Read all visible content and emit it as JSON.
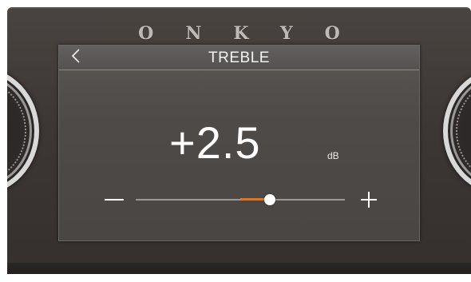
{
  "device": {
    "brand": "ONKYO"
  },
  "screen": {
    "title": "TREBLE",
    "back_icon": "chevron-left-icon",
    "value_text": "+2.5",
    "unit": "dB"
  },
  "slider": {
    "min_label_icon": "minus-icon",
    "max_label_icon": "plus-icon",
    "center_fraction": 0.5,
    "level_fraction": 0.64,
    "accent_color": "#e8731e"
  }
}
